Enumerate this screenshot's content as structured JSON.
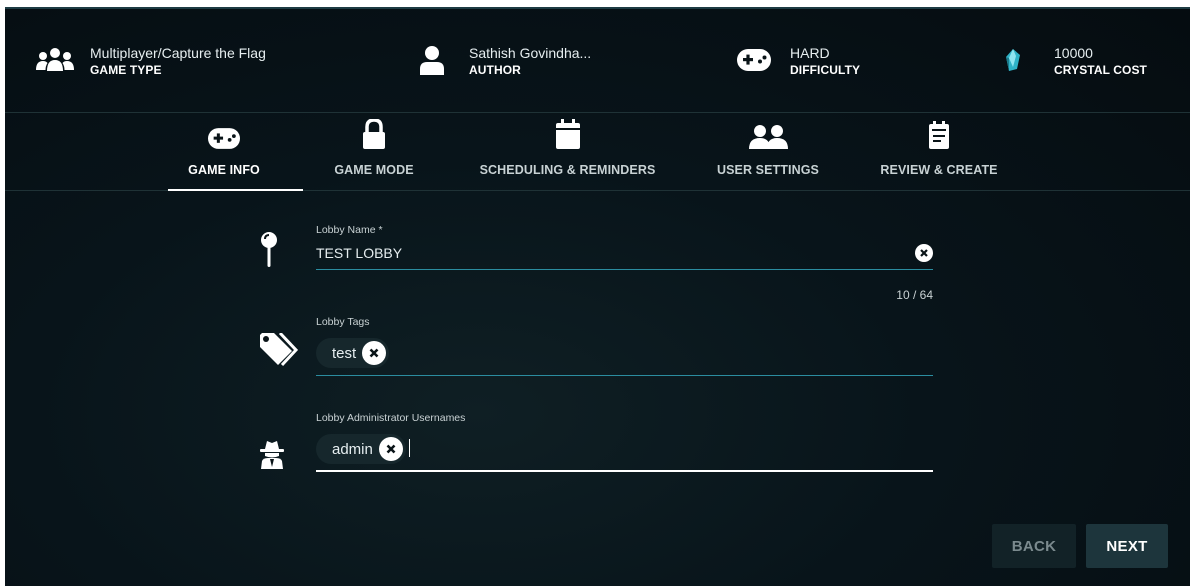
{
  "summary": {
    "game_type": {
      "value": "Multiplayer/Capture the Flag",
      "label": "GAME TYPE",
      "icon": "users-icon"
    },
    "author": {
      "value": "Sathish Govindha...",
      "label": "AUTHOR",
      "icon": "user-icon"
    },
    "difficulty": {
      "value": "HARD",
      "label": "DIFFICULTY",
      "icon": "gamepad-icon"
    },
    "crystal_cost": {
      "value": "10000",
      "label": "CRYSTAL COST",
      "icon": "crystal-icon"
    }
  },
  "tabs": [
    {
      "label": "GAME INFO",
      "icon": "gamepad-icon",
      "active": true
    },
    {
      "label": "GAME MODE",
      "icon": "lock-icon",
      "active": false
    },
    {
      "label": "SCHEDULING & REMINDERS",
      "icon": "calendar-icon",
      "active": false
    },
    {
      "label": "USER SETTINGS",
      "icon": "users-icon",
      "active": false
    },
    {
      "label": "REVIEW & CREATE",
      "icon": "clipboard-icon",
      "active": false
    }
  ],
  "form": {
    "lobby_name": {
      "label": "Lobby Name *",
      "value": "TEST LOBBY",
      "counter": "10 / 64",
      "icon": "pin-icon"
    },
    "lobby_tags": {
      "label": "Lobby Tags",
      "chips": [
        "test"
      ],
      "icon": "tags-icon"
    },
    "lobby_admins": {
      "label": "Lobby Administrator Usernames",
      "chips": [
        "admin"
      ],
      "icon": "spy-icon"
    }
  },
  "buttons": {
    "back": "BACK",
    "next": "NEXT"
  },
  "colors": {
    "background": "#08141a",
    "accent_line": "#2b8da0",
    "button_active": "#1d353c",
    "button_disabled": "#122227"
  }
}
